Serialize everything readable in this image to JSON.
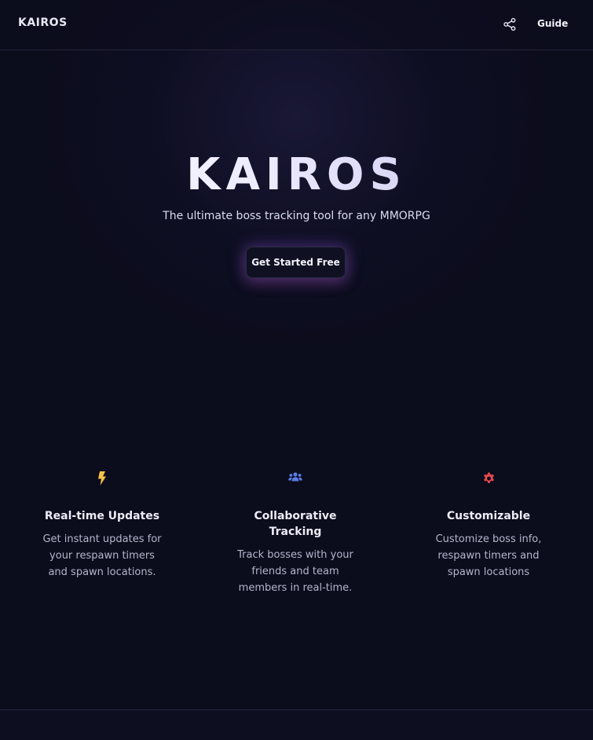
{
  "header": {
    "brand": "KAIROS",
    "share_icon": "share-icon",
    "guide_label": "Guide"
  },
  "hero": {
    "title": "KAIROS",
    "subtitle": "The ultimate boss tracking tool for any MMORPG",
    "cta_label": "Get Started Free"
  },
  "features": [
    {
      "icon": "lightning-icon",
      "icon_color": "#f5c24a",
      "title": "Real-time Updates",
      "description": "Get instant updates for your respawn timers and spawn locations."
    },
    {
      "icon": "users-icon",
      "icon_color": "#5b7be6",
      "title": "Collaborative Tracking",
      "description": "Track bosses with your friends and team members in real-time."
    },
    {
      "icon": "gear-icon",
      "icon_color": "#e5484d",
      "title": "Customizable",
      "description": "Customize boss info, respawn timers and spawn locations"
    }
  ]
}
